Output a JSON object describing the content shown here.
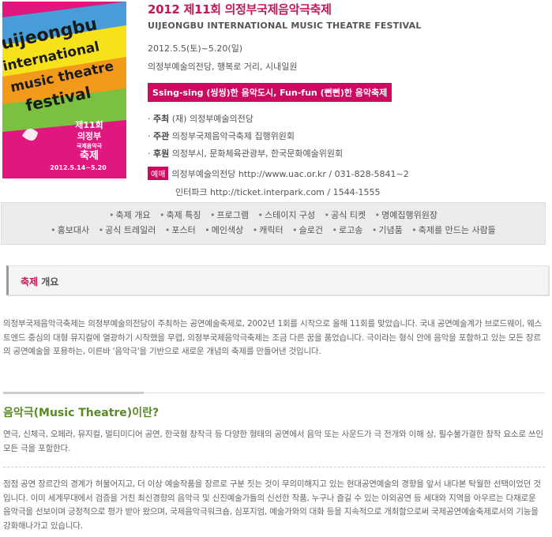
{
  "poster": {
    "lines": [
      "uijeongbu",
      "international",
      "music theatre",
      "festival"
    ],
    "edition": "제11회",
    "city": "의정부",
    "subtitle": "국제음악극",
    "fest": "축제",
    "dates": "2012.5.14~5.20",
    "colors": {
      "bg": "#e0177e",
      "yellow": "#f6e21a",
      "orange": "#f39a1c",
      "green": "#7ac142",
      "cyan": "#2bb5e8"
    }
  },
  "header": {
    "title_ko": "2012 제11회 의정부국제음악극축제",
    "title_en": "UIJEONGBU INTERNATIONAL MUSIC THEATRE FESTIVAL",
    "date": "2012.5.5(토)~5.20(일)",
    "venue": "의정부예술의전당, 행복로 거리, 시내일원",
    "slogan": "Ssing-sing (씽씽)한 음악도시, Fun-fun (뻔뻔)한 음악축제"
  },
  "roles": [
    {
      "label": "주최",
      "value": "(재) 의정부예술의전당"
    },
    {
      "label": "주관",
      "value": "의정부국제음악극축제 집행위원회"
    },
    {
      "label": "후원",
      "value": "의정부시, 문화체육관광부, 한국문화예술위원회"
    }
  ],
  "ticket": {
    "tag": "예매",
    "line1": "의정부예술의전당 http://www.uac.or.kr / 031-828-5841~2",
    "line2": "인터파크 http://ticket.interpark.com / 1544-1555"
  },
  "menu": {
    "row1": [
      "축제 개요",
      "축제 특징",
      "프로그램",
      "스테이지 구성",
      "공식 티켓",
      "명예집행위원장"
    ],
    "row2": [
      "홍보대사",
      "공식 트레일러",
      "포스터",
      "메인색상",
      "캐릭터",
      "슬로건",
      "로고송",
      "기념품",
      "축제를 만드는 사람들"
    ]
  },
  "section": {
    "highlight": "축제",
    "rest": " 개요"
  },
  "content": {
    "p1": "의정부국제음악극축제는 의정부예술의전당이 주최하는 공연예술축제로, 2002년 1회를 시작으로 올해 11회를 맞았습니다. 국내 공연예술계가 브로드웨이, 웨스트엔드 중심의 대형 뮤지컬에 열광하기 시작했을 무렵, 의정부국제음악극축제는 조금 다른 꿈을 품었습니다. 극이라는 형식 안에 음악을 포함하고 있는 모든 장르의 공연예술을 포용하는, 이른바 '음악극'을 기반으로 새로운 개념의 축제를 만들어낸 것입니다.",
    "h2": "음악극(Music Theatre)이란?",
    "p2": "연극, 신체극, 오페라, 뮤지컬, 멀티미디어 공연, 한국형 창작극 등 다양한 형태의 공연에서 음악 또는 사운드가 극 전개와 이해 상, 필수불가결한 창작 요소로 쓰인 모든 극을 포함한다.",
    "p3": "점점 공연 장르간의 경계가 허물어지고, 더 이상 예술작품을 장르로 구분 짓는 것이 무의미해지고 있는 현대공연예술의 경향을 앞서 내다본 탁월한 선택이었던 것입니다. 이미 세계무대에서 검증을 거친 최신경향의 음악극 및 신진예술가들의 신선한 작품, 누구나 즐길 수 있는 야외공연 등 세대와 지역을 아우르는 다채로운 음악극을 선보이며 긍정적으로 평가 받아 왔으며, 국제음악극워크숍, 심포지엄, 예술가와의 대화 등을 지속적으로 개최함으로써 국제공연예술축제로서의 기능을 강화해나가고 있습니다."
  }
}
